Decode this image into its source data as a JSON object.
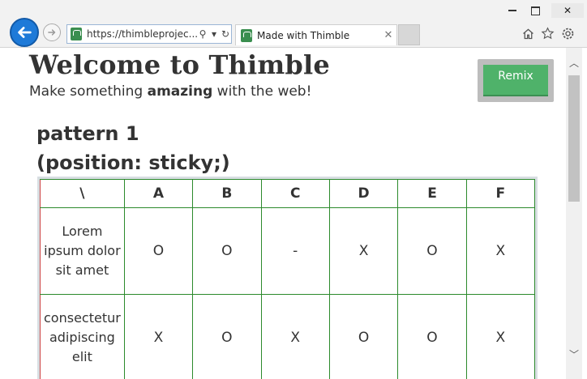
{
  "browser": {
    "address_url": "https://thimbleprojec...",
    "tab_title": "Made with Thimble",
    "icons": [
      "back-icon",
      "forward-icon",
      "search-icon",
      "dropdown-icon",
      "refresh-icon",
      "home-icon",
      "favorites-icon",
      "settings-icon",
      "minimize-icon",
      "maximize-icon",
      "close-icon"
    ]
  },
  "page": {
    "title": "Welcome to Thimble",
    "subtitle_prefix": "Make something ",
    "subtitle_bold": "amazing",
    "subtitle_suffix": " with the web!",
    "remix_label": "Remix",
    "pattern_title_line1": "pattern 1",
    "pattern_title_line2": "(position: sticky;)"
  },
  "table": {
    "corner": "\\",
    "headers": [
      "A",
      "B",
      "C",
      "D",
      "E",
      "F"
    ],
    "rows": [
      {
        "label": "Lorem ipsum dolor sit amet",
        "cells": [
          "O",
          "O",
          "-",
          "X",
          "O",
          "X"
        ]
      },
      {
        "label": "consectetur adipiscing elit",
        "cells": [
          "X",
          "O",
          "X",
          "O",
          "O",
          "X"
        ]
      }
    ]
  },
  "colors": {
    "accent": "#4fb26a",
    "table_border": "#2c8a2c",
    "sticky_edge": "#cc4444"
  }
}
